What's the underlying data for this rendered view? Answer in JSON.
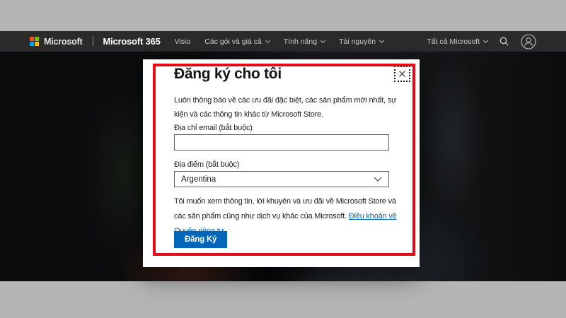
{
  "navbar": {
    "logo": "Microsoft",
    "product": "Microsoft 365",
    "items": [
      {
        "label": "Visio",
        "dropdown": false
      },
      {
        "label": "Các gói và giá cả",
        "dropdown": true
      },
      {
        "label": "Tính năng",
        "dropdown": true
      },
      {
        "label": "Tài nguyên",
        "dropdown": true
      }
    ],
    "all_microsoft": "Tất cả Microsoft",
    "icons": [
      "microsoft-logo",
      "chevron-down-icon",
      "search-icon",
      "account-icon"
    ]
  },
  "modal": {
    "title": "Đăng ký cho tôi",
    "description": "Luôn thông báo về các ưu đãi đặc biệt, các sản phẩm mới nhất, sự kiện và các thông tin khác từ Microsoft Store.",
    "email": {
      "label": "Địa chỉ email (bắt buộc)",
      "value": "",
      "placeholder": ""
    },
    "location": {
      "label": "Địa điểm (bắt buộc)",
      "selected": "Argentina"
    },
    "consent_text": "Tôi muốn xem thông tin, lời khuyên và ưu đãi về Microsoft Store và các sản phẩm cũng như dịch vụ khác của Microsoft. ",
    "privacy_link_label": "Điều khoản về Quyền riêng tư",
    "submit_label": "Đăng Ký",
    "icons": [
      "close-icon",
      "chevron-down-icon"
    ]
  },
  "colors": {
    "accent_blue": "#0067b8",
    "link_blue": "#0067b8",
    "annotation_red": "#e50b14",
    "navbar_bg": "#2b2b2b",
    "letterbox_gray": "#b5b5b5",
    "logo_red": "#f25022",
    "logo_green": "#7fba00",
    "logo_blue": "#00a4ef",
    "logo_yellow": "#ffb900"
  }
}
